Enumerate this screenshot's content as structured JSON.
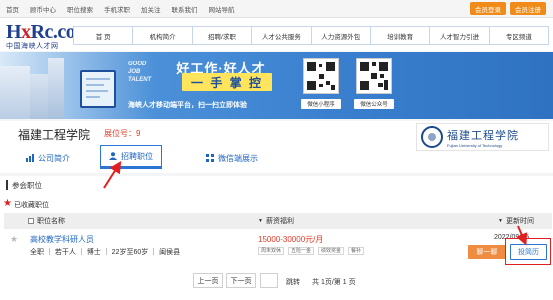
{
  "topbar": {
    "links": [
      "首页",
      "顾币中心",
      "职位搜索",
      "手机求职",
      "加关注",
      "联系我们",
      "网站导航"
    ],
    "login_label": "会员登录",
    "register_label": "会员注册"
  },
  "logo": {
    "main_prefix": "H",
    "main_x": "x",
    "main_rest": "Rc.com",
    "sub": "中国海峡人才网"
  },
  "main_nav": [
    "首 页",
    "机构简介",
    "招聘/求职",
    "人才公共服务",
    "人力资源外包",
    "培训教育",
    "人才智力引进",
    "专区频道"
  ],
  "banner": {
    "good_job": "GOOD\nJOB\nTALENT",
    "slogan_top": "好工作·好人才",
    "slogan_badge": "一 手 掌 控",
    "subtitle": "海峡人才移动端平台，扫一扫立即体验",
    "qr_labels": [
      "微信小程序",
      "微信公众号"
    ]
  },
  "company": {
    "name": "福建工程学院",
    "rank": "展位号：9",
    "logo_cn": "福建工程学院",
    "logo_en": "Fujian University of Technology"
  },
  "tabs": [
    "公司简介",
    "招聘职位",
    "微信端展示"
  ],
  "section": {
    "title": "参会职位",
    "favorites_label": "已收藏职位",
    "columns": [
      "职位名称",
      "薪资福利",
      "更新时间"
    ]
  },
  "job": {
    "title": "高校教学科研人员",
    "meta": "全职 ｜ 若干人 ｜ 博士 ｜ 22岁至60岁 ｜ 闽侯县",
    "salary": "15000-30000元/月",
    "tags": [
      "周末双休",
      "五险一金",
      "绩效奖金",
      "餐补"
    ],
    "updated": "2022/09/05",
    "chat_label": "聊一聊",
    "apply_label": "投简历"
  },
  "pager": {
    "prev_label": "上一页",
    "next_label": "下一页",
    "jump_label": "跳转",
    "summary": "共 1页/第 1 页"
  },
  "colors": {
    "accent_blue": "#2c74d6",
    "orange": "#f08b1a",
    "red": "#e02020"
  }
}
